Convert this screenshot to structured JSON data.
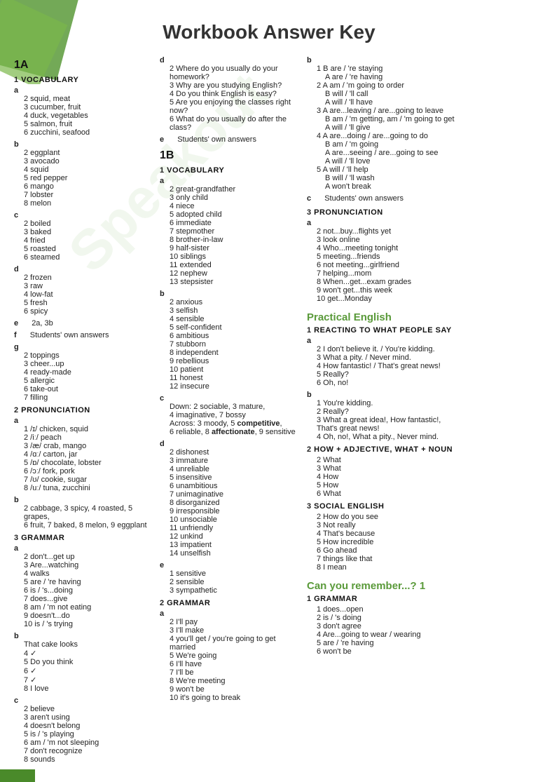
{
  "page": {
    "title": "Workbook Answer Key"
  },
  "unit1a": {
    "label": "1A",
    "sections": {
      "vocabulary": {
        "num": "1",
        "title": "VOCABULARY",
        "a": [
          "2 squid, meat",
          "3 cucumber, fruit",
          "4 duck, vegetables",
          "5 salmon, fruit",
          "6 zucchini, seafood"
        ],
        "b": [
          "2 eggplant",
          "3 avocado",
          "4 squid",
          "5 red pepper",
          "6 mango",
          "7 lobster",
          "8 melon"
        ],
        "c": [
          "2 boiled",
          "3 baked",
          "4 fried",
          "5 roasted",
          "6 steamed"
        ],
        "d": [
          "2 frozen",
          "3 raw",
          "4 low-fat",
          "5 fresh",
          "6 spicy"
        ],
        "e": "2a, 3b",
        "f": "Students' own answers",
        "g": [
          "2 toppings",
          "3 cheer...up",
          "4 ready-made",
          "5 allergic",
          "6 take-out",
          "7 filling"
        ]
      },
      "pronunciation": {
        "num": "2",
        "title": "PRONUNCIATION",
        "a": [
          "1 /ɪ/ chicken, squid",
          "2 /iː/ peach",
          "3 /æ/ crab, mango",
          "4 /ɑː/ carton, jar",
          "5 /ɒ/ chocolate, lobster",
          "6 /ɔː/ fork, pork",
          "7 /ʊ/ cookie, sugar",
          "8 /uː/ tuna, zucchini"
        ],
        "b": "2 cabbage, 3 spicy, 4 roasted, 5 grapes, 6 fruit, 7 baked, 8 melon, 9 eggplant"
      },
      "grammar": {
        "num": "3",
        "title": "GRAMMAR",
        "a": [
          "2 don't...get up",
          "3 Are...watching",
          "4 walks",
          "5 are / 're having",
          "6 is / 's...doing",
          "7 does...give",
          "8 am / 'm not eating",
          "9 doesn't...do",
          "10 is / 's trying"
        ],
        "b_intro": "That cake looks",
        "b_items": [
          "4 ✓",
          "5 Do you think",
          "6 ✓",
          "7 ✓",
          "8 I love"
        ],
        "c": [
          "2 believe",
          "3 aren't using",
          "4 doesn't belong",
          "5 is / 's playing",
          "6 am / 'm not sleeping",
          "7 don't recognize",
          "8 sounds"
        ]
      }
    }
  },
  "unit1b": {
    "label": "1B",
    "sections": {
      "vocabulary": {
        "num": "1",
        "title": "VOCABULARY",
        "a": [
          "2 great-grandfather",
          "3 only child",
          "4 niece",
          "5 adopted child",
          "6 immediate",
          "7 stepmother",
          "8 brother-in-law",
          "9 half-sister",
          "10 siblings",
          "11 extended",
          "12 nephew",
          "13 stepsister"
        ],
        "b": [
          "2 anxious",
          "3 selfish",
          "4 sensible",
          "5 self-confident",
          "6 ambitious",
          "7 stubborn",
          "8 independent",
          "9 rebellious",
          "10 patient",
          "11 honest",
          "12 insecure"
        ],
        "c": "Down: 2 sociable, 3 mature, 4 imaginative, 7 bossy\nAcross: 3 moody, 5 competitive, 6 reliable, 8 affectionate, 9 sensitive",
        "d": [
          "2 dishonest",
          "3 immature",
          "4 unreliable",
          "5 insensitive",
          "6 unambitious",
          "7 unimaginative",
          "8 disorganized",
          "9 irresponsible",
          "10 unsociable",
          "11 unfriendly",
          "12 unkind",
          "13 impatient",
          "14 unselfish"
        ],
        "e": [
          "1 sensitive",
          "2 sensible",
          "3 sympathetic"
        ]
      },
      "grammar": {
        "num": "2",
        "title": "GRAMMAR",
        "a": [
          "2 I'll pay",
          "3 I'll make",
          "4 you'll get / you're going to get married",
          "5 We're going",
          "6 I'll have",
          "7 I'll be",
          "8 We're meeting",
          "9 won't be",
          "10 it's going to break"
        ],
        "d2_header": "2 Where do you usually do your homework?",
        "d_items": [
          "3 Why are you studying English?",
          "4 Do you think English is easy?",
          "5 Are you enjoying the classes right now?",
          "6 What do you usually do after the class?"
        ],
        "e": "Students' own answers"
      }
    }
  },
  "practical_english": {
    "label": "Practical English",
    "sections": {
      "reacting": {
        "num": "1",
        "title": "REACTING TO WHAT PEOPLE SAY",
        "a": [
          "2 I don't believe it. / You're kidding.",
          "3 What a pity. / Never mind.",
          "4 How fantastic! / That's great news!",
          "5 Really?",
          "6 Oh, no!"
        ],
        "b": [
          "1 You're kidding.",
          "2 Really?",
          "3 What a great idea!, How fantastic!, That's great news!",
          "4 Oh, no!, What a pity., Never mind."
        ]
      },
      "how_adjective": {
        "num": "2",
        "title": "HOW + ADJECTIVE, WHAT + NOUN",
        "items": [
          "2 What",
          "3 What",
          "4 How",
          "5 How",
          "6 What"
        ]
      },
      "social_english": {
        "num": "3",
        "title": "SOCIAL ENGLISH",
        "items": [
          "2 How do you see",
          "3 Not really",
          "4 That's because",
          "5 How incredible",
          "6 Go ahead",
          "7 things like that",
          "8 I mean"
        ]
      }
    }
  },
  "can_remember": {
    "label": "Can you remember...? 1",
    "sections": {
      "grammar": {
        "num": "1",
        "title": "GRAMMAR",
        "items": [
          "1 does...open",
          "2 is / 's doing",
          "3 don't agree",
          "4 Are...going to wear / wearing",
          "5 are / 're having",
          "6 won't be"
        ]
      }
    }
  },
  "right_col_b_section": {
    "b_header": "b",
    "b_items": [
      "1 B are / 're staying",
      "A are / 're having",
      "2 A am / 'm going to order",
      "B will / 'll call",
      "A will / 'll have",
      "3 A are...leaving / are...going to leave",
      "B am / 'm getting, am / 'm going to get",
      "A will / 'll give",
      "4 A are...doing / are...going to do",
      "B am / 'm going",
      "A are...seeing / are...going to see",
      "A will / 'll love",
      "5 A will / 'll help",
      "B will / 'll wash",
      "A won't break"
    ],
    "c": "Students' own answers"
  },
  "pronunciation_1b": {
    "num": "3",
    "title": "PRONUNCIATION",
    "a": [
      "2 not...buy...flights yet",
      "3 look online",
      "4 Who...meeting tonight",
      "5 meeting...friends",
      "6 not meeting...girlfriend",
      "7 helping...mom",
      "8 When...get...exam grades",
      "9 won't get...this week",
      "10 get...Monday"
    ]
  }
}
